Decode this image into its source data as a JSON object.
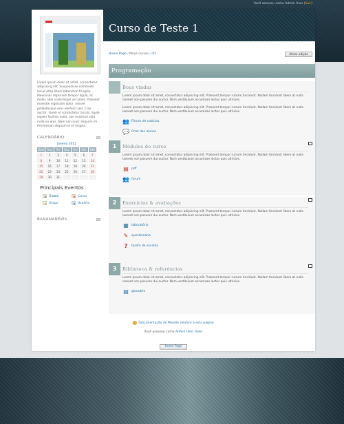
{
  "login_info": {
    "text": "Você acessou como Admin User (",
    "logout": "Sair",
    "close": ")"
  },
  "course": {
    "title": "Curso de Teste 1"
  },
  "breadcrumb": {
    "home": "Home Page",
    "sep": "/",
    "my_courses": "Meus cursos",
    "sep2": "/",
    "current": "ct1"
  },
  "edit_button": "Ativar edição",
  "intro_text": "Lorem ipsum dolor sit amet, consectetur adipiscing elit. Suspendisse commodo lacus vitae libero bibendum fringilla. Maecenas dignissim tempor ligula, ac mollis nibh scelerisque vel amet. Praesent molestie dignissim dolor, ornare pellentesque eros eleifend sed. Cras auctor, lorem et consectetur iaculis, ligula sapien facilisis nulla, non euismod velit nulla eu eros. Nam non nunc aliquam mi fermentum aliquam id et magna.",
  "calendar": {
    "title": "CALENDÁRIO",
    "month": "janeiro 2012",
    "weekdays": [
      "Dom",
      "Seg",
      "Ter",
      "Qua",
      "Qui",
      "Sex",
      "Sáb"
    ],
    "days": [
      "1",
      "2",
      "3",
      "4",
      "5",
      "6",
      "7",
      "8",
      "9",
      "10",
      "11",
      "12",
      "13",
      "14",
      "15",
      "16",
      "17",
      "18",
      "19",
      "20",
      "21",
      "22",
      "23",
      "24",
      "25",
      "26",
      "27",
      "28",
      "29",
      "30",
      "31",
      "",
      "",
      "",
      ""
    ]
  },
  "events": {
    "title": "Principais Eventos",
    "items": [
      "Global",
      "Curso",
      "Grupo",
      "Usuário"
    ]
  },
  "news_block": {
    "title": "BANANANEWS"
  },
  "program": {
    "title": "Programação"
  },
  "lorem": "Lorem ipsum dolor sit amet, consectetur adipiscing elit. Praesent tempor rutrum tincidunt. Nullam tincidunt libero at nulla laoreet non posuere dui auctor. Nam vestibulum accumsan lectus quis ultricies.",
  "sections": [
    {
      "num": "",
      "title": "Boas vindas",
      "resources": [
        "Fórum de notícias",
        "Chat dos alunos"
      ]
    },
    {
      "num": "1",
      "title": "Módulos do curso",
      "resources": [
        "pdf",
        "forum"
      ]
    },
    {
      "num": "2",
      "title": "Exercícios & avaliações",
      "resources": [
        "laboratório",
        "questionário",
        "tarefa de escolha"
      ]
    },
    {
      "num": "3",
      "title": "Biblioteca & referências",
      "resources": [
        "glossário"
      ]
    }
  ],
  "footer": {
    "doc": "Documentação do Moodle relativa a esta página",
    "logged_prefix": "Você acessou como ",
    "logged_user": "Admin User",
    "logout": "(Sair)",
    "home": "Home Page"
  }
}
